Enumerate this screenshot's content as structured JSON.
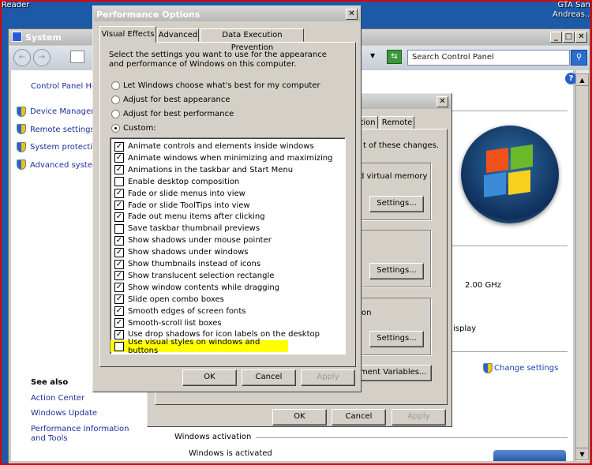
{
  "desktop": {
    "icon_left": "Reader",
    "icon_right": "GTA San Andreas..."
  },
  "system_window": {
    "title": "System",
    "search_placeholder": "Search Control Panel",
    "left_nav": {
      "home": "Control Panel Hom",
      "links": [
        "Device Manager",
        "Remote settings",
        "System protection",
        "Advanced system"
      ],
      "see_also_heading": "See also",
      "see_also": [
        "Action Center",
        "Windows Update",
        "Performance Information and Tools"
      ]
    },
    "content": {
      "processor_speed": "2.00 GHz",
      "display_fragment": "isplay",
      "change_settings": "Change settings",
      "activation_heading": "Windows activation",
      "activation_status": "Windows is activated"
    }
  },
  "system_properties": {
    "tabs": [
      "tion",
      "Remote"
    ],
    "intro_fragment": "t of these changes.",
    "perf_group_fragment": "d virtual memory",
    "startup_fragment": "on",
    "settings_label": "Settings...",
    "env_vars_label": "onment Variables...",
    "ok": "OK",
    "cancel": "Cancel",
    "apply": "Apply"
  },
  "performance_options": {
    "title": "Performance Options",
    "tabs": [
      "Visual Effects",
      "Advanced",
      "Data Execution Prevention"
    ],
    "active_tab": "Visual Effects",
    "intro": "Select the settings you want to use for the appearance and performance of Windows on this computer.",
    "radios": [
      {
        "label": "Let Windows choose what's best for my computer",
        "selected": false
      },
      {
        "label": "Adjust for best appearance",
        "selected": false
      },
      {
        "label": "Adjust for best performance",
        "selected": false
      },
      {
        "label": "Custom:",
        "selected": true
      }
    ],
    "effects": [
      {
        "label": "Animate controls and elements inside windows",
        "checked": true
      },
      {
        "label": "Animate windows when minimizing and maximizing",
        "checked": true
      },
      {
        "label": "Animations in the taskbar and Start Menu",
        "checked": true
      },
      {
        "label": "Enable desktop composition",
        "checked": false
      },
      {
        "label": "Fade or slide menus into view",
        "checked": true
      },
      {
        "label": "Fade or slide ToolTips into view",
        "checked": true
      },
      {
        "label": "Fade out menu items after clicking",
        "checked": true
      },
      {
        "label": "Save taskbar thumbnail previews",
        "checked": false
      },
      {
        "label": "Show shadows under mouse pointer",
        "checked": true
      },
      {
        "label": "Show shadows under windows",
        "checked": true
      },
      {
        "label": "Show thumbnails instead of icons",
        "checked": true
      },
      {
        "label": "Show translucent selection rectangle",
        "checked": true
      },
      {
        "label": "Show window contents while dragging",
        "checked": true
      },
      {
        "label": "Slide open combo boxes",
        "checked": true
      },
      {
        "label": "Smooth edges of screen fonts",
        "checked": true
      },
      {
        "label": "Smooth-scroll list boxes",
        "checked": true
      },
      {
        "label": "Use drop shadows for icon labels on the desktop",
        "checked": true
      },
      {
        "label": "Use visual styles on windows and buttons",
        "checked": false,
        "highlighted": true
      }
    ],
    "highlight_color": "#ffff00",
    "ok": "OK",
    "cancel": "Cancel",
    "apply": "Apply"
  }
}
